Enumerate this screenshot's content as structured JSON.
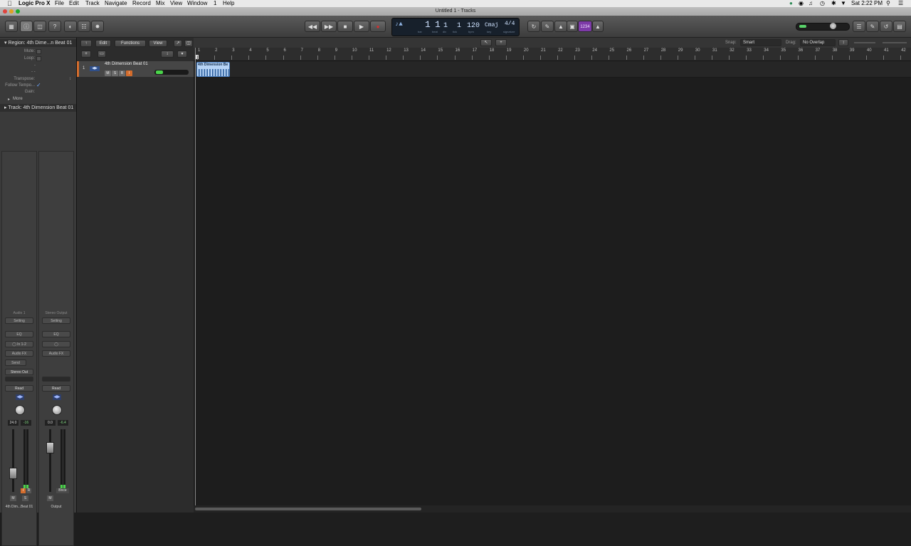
{
  "menubar": {
    "apple": "",
    "app": "Logic Pro X",
    "items": [
      "File",
      "Edit",
      "Track",
      "Navigate",
      "Record",
      "Mix",
      "View",
      "Window",
      "1",
      "Help"
    ],
    "clock": "Sat 2:22 PM"
  },
  "window": {
    "title": "Untitled 1 - Tracks"
  },
  "lcd": {
    "bar": "1",
    "beat": "1",
    "div": "1",
    "tick": "1",
    "tempo": "120",
    "key": "Cmaj",
    "signature": "4/4",
    "labels": {
      "bar": "bar",
      "beat": "beat",
      "div": "div",
      "tick": "tick",
      "tempo": "bpm",
      "key": "key",
      "signature": "signature"
    }
  },
  "count_in": "1234",
  "inspector": {
    "region_header": "Region: 4th Dime...n Beat 01",
    "mute": "Mute:",
    "loop": "Loop:",
    "dash1": "-",
    "dash2": "-  -",
    "transpose": "Transpose:",
    "follow_tempo": "Follow Tempo...",
    "gain": "Gain:",
    "more": "More",
    "track_header": "Track:  4th Dimension Beat 01"
  },
  "strips": [
    {
      "name_top": "Audio 1",
      "setting": "Setting",
      "eq": "EQ",
      "input": "In 1-2",
      "audio_fx": "Audio FX",
      "send": "Send",
      "output": "Stereo Out",
      "read": "Read",
      "vol": "24.0",
      "peak": "-16",
      "meter_label": "",
      "bottom": "4th Dim...Beat 01"
    },
    {
      "name_top": "Stereo Output",
      "setting": "Setting",
      "eq": "EQ",
      "input": "",
      "audio_fx": "Audio FX",
      "send": "",
      "output": "",
      "read": "Read",
      "vol": "0.0",
      "peak": "-6.4",
      "meter_label": "Bnce",
      "bottom": "Output"
    }
  ],
  "strip_buttons": {
    "m": "M",
    "s": "S",
    "i": "I",
    "r": "R"
  },
  "trackhdr": {
    "edit": "Edit",
    "functions": "Functions",
    "view": "View",
    "add": "+"
  },
  "tracks": [
    {
      "number": "1",
      "name": "4th Dimension Beat 01",
      "m": "M",
      "s": "S",
      "r": "R",
      "i": "I"
    }
  ],
  "arrange": {
    "snap_label": "Snap:",
    "snap_value": "Smart",
    "drag_label": "Drag:",
    "drag_value": "No Overlap"
  },
  "ruler": [
    "1",
    "2",
    "3",
    "4",
    "5",
    "6",
    "7",
    "8",
    "9",
    "10",
    "11",
    "12",
    "13",
    "14",
    "15",
    "16",
    "17",
    "18",
    "19",
    "20",
    "21",
    "22",
    "23",
    "24",
    "25",
    "26",
    "27",
    "28",
    "29",
    "30",
    "31",
    "32",
    "33",
    "34",
    "35",
    "36",
    "37",
    "38",
    "39",
    "40",
    "41",
    "42"
  ],
  "region": {
    "name": "4th Dimension Beat 01",
    "label_visible": "4th Dimension Be"
  },
  "colors": {
    "track_accent": "#d36c2c",
    "region": "#b6d3f5",
    "record": "#d33030",
    "count_in": "#7d3aa8"
  }
}
